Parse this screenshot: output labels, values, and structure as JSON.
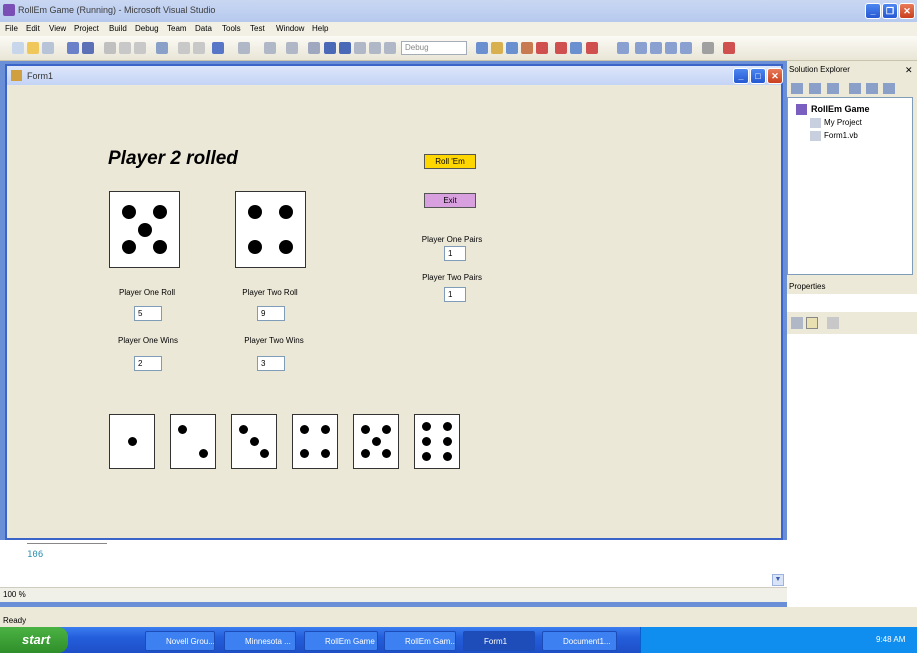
{
  "window": {
    "title": "RollEm Game (Running) - Microsoft Visual Studio"
  },
  "menu": [
    "File",
    "Edit",
    "View",
    "Project",
    "Build",
    "Debug",
    "Team",
    "Data",
    "Tools",
    "Test",
    "Window",
    "Help"
  ],
  "toolbar": {
    "config_value": "Debug"
  },
  "form": {
    "title": "Form1",
    "heading": "Player 2 rolled",
    "roll_button": "Roll 'Em",
    "exit_button": "Exit",
    "p1_pairs_label": "Player One Pairs",
    "p1_pairs_value": "1",
    "p2_pairs_label": "Player Two Pairs",
    "p2_pairs_value": "1",
    "p1_roll_label": "Player One Roll",
    "p1_roll_value": "5",
    "p2_roll_label": "Player Two Roll",
    "p2_roll_value": "9",
    "p1_wins_label": "Player One Wins",
    "p1_wins_value": "2",
    "p2_wins_label": "Player Two Wins",
    "p2_wins_value": "3",
    "rolled_dice": [
      5,
      4
    ],
    "reference_dice": [
      1,
      2,
      3,
      4,
      5,
      6
    ],
    "roll_color": "#ffd700",
    "exit_color": "#d9a0e0"
  },
  "code": {
    "line_number": "106"
  },
  "zoom": "100 %",
  "solution_explorer": {
    "title": "Solution Explorer",
    "project": "RollEm Game",
    "items": [
      "My Project",
      "Form1.vb"
    ]
  },
  "properties": {
    "title": "Properties"
  },
  "status": "Ready",
  "taskbar": {
    "start": "start",
    "tasks": [
      "Novell Grou...",
      "Minnesota ...",
      "RollEm Game",
      "RollEm Gam...",
      "Form1",
      "Document1..."
    ],
    "clock": "9:48 AM"
  }
}
